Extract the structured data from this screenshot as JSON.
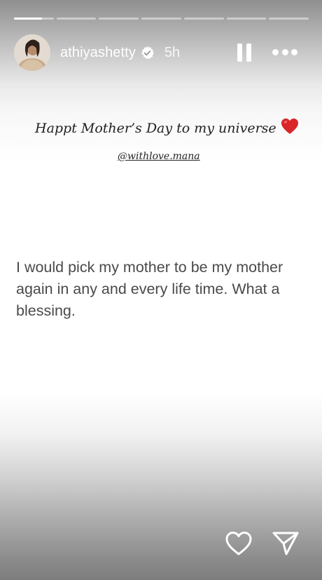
{
  "progress": {
    "segments": [
      0.7,
      0,
      0,
      0,
      0,
      0,
      0
    ]
  },
  "header": {
    "username": "athiyashetty",
    "verified": true,
    "time": "5h"
  },
  "story": {
    "caption": "Happt Mother’s Day to my universe",
    "caption_emoji": "red-heart-emoji",
    "mention": "@withlove.mana",
    "quote": "I would pick my mother to be my mother again in any and every life time. What a blessing."
  },
  "actions": {
    "like_icon": "heart-outline-icon",
    "share_icon": "paper-plane-icon"
  },
  "colors": {
    "text_dark": "#222222",
    "quote_text": "#4a4a4a",
    "heart_red": "#d9262a",
    "white": "#ffffff"
  }
}
